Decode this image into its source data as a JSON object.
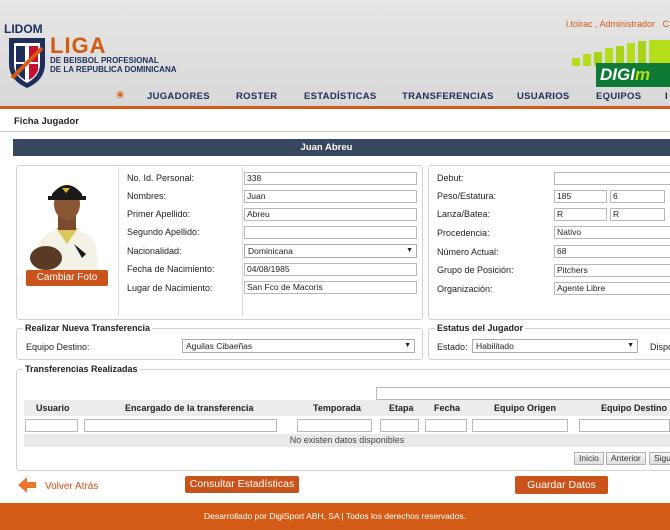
{
  "brand": {
    "lidom": "LIDOM",
    "liga": "LIGA",
    "sub1": "DE BEISBOL PROFESIONAL",
    "sub2": "DE LA REPUBLICA DOMINICANA",
    "sponsor_a": "DIGI",
    "sponsor_b": "m",
    "accent": "#d65a10",
    "navy": "#1e2d5c"
  },
  "user": {
    "name": "l.toirac , Administrador",
    "trailing": "C"
  },
  "nav": {
    "home_icon": "home-icon",
    "items": [
      "JUGADORES",
      "ROSTER",
      "ESTADÍSTICAS",
      "TRANSFERENCIAS",
      "USUARIOS",
      "EQUIPOS",
      "I"
    ]
  },
  "page": {
    "title": "Ficha Jugador",
    "player_name": "Juan Abreu"
  },
  "profile": {
    "photo_button": "Cambiar Foto",
    "fields": {
      "id_label": "No. Id. Personal:",
      "id_value": "338",
      "nombres_label": "Nombres:",
      "nombres_value": "Juan",
      "apellido1_label": "Primer Apellido:",
      "apellido1_value": "Abreu",
      "apellido2_label": "Segundo Apellido:",
      "apellido2_value": "",
      "nacionalidad_label": "Nacionalidad:",
      "nacionalidad_value": "Dominicana",
      "nacimiento_label": "Fecha de Nacimiento:",
      "nacimiento_value": "04/08/1985",
      "lugar_label": "Lugar de Nacimiento:",
      "lugar_value": "San Fco de Macoris"
    }
  },
  "details": {
    "debut_label": "Debut:",
    "debut_value": "",
    "peso_label": "Peso/Estatura:",
    "peso_value": "185",
    "estatura_value": "6",
    "lanza_label": "Lanza/Batea:",
    "lanza_value": "R",
    "batea_value": "R",
    "procedencia_label": "Procedencia:",
    "procedencia_value": "Nativo",
    "numero_label": "Número Actual:",
    "numero_value": "68",
    "grupo_label": "Grupo de Posición:",
    "grupo_value": "Pitchers",
    "org_label": "Organización:",
    "org_value": "Agente Libre"
  },
  "transfer": {
    "legend": "Realizar Nueva Transferencia",
    "destino_label": "Equipo Destino:",
    "destino_value": "Aguilas Cibaeñas"
  },
  "status": {
    "legend": "Estatus del Jugador",
    "estado_label": "Estado:",
    "estado_value": "Habilitado",
    "trailing_label": "Dispo"
  },
  "history": {
    "legend": "Transferencias Realizadas",
    "columns": [
      "Usuario",
      "Encargado de la transferencia",
      "Temporada",
      "Etapa",
      "Fecha",
      "Equipo Origen",
      "Equipo Destino"
    ],
    "empty": "No existen datos disponibles",
    "pager": [
      "Inicio",
      "Anterior",
      "Sigu"
    ]
  },
  "actions": {
    "back": "Volver Atrás",
    "stats": "Consultar Estadísticas",
    "save": "Guardar Datos"
  },
  "footer": "Desarrollado por DigiSport ABH, SA | Todos los derechos reservados."
}
